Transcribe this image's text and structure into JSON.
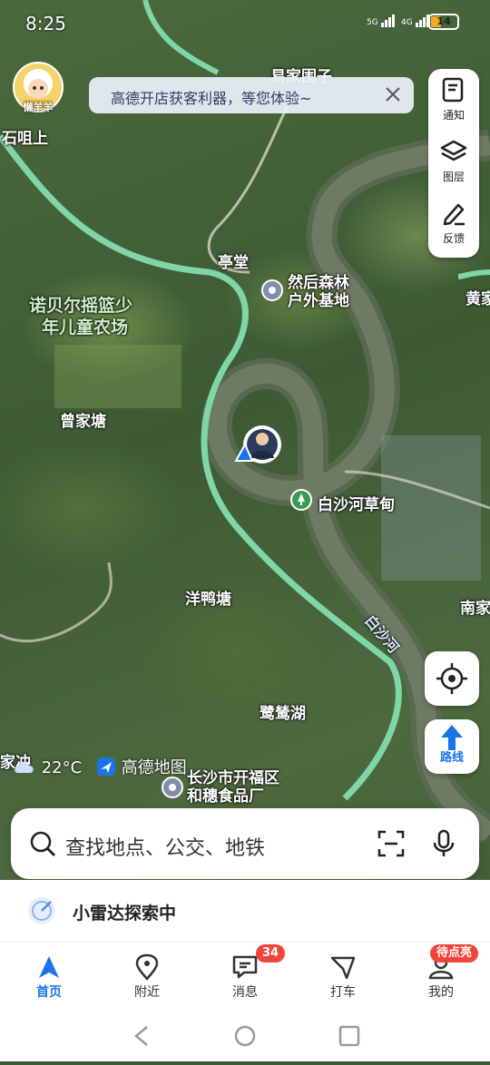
{
  "status_bar": {
    "time": "8:25",
    "signal1": "5G",
    "signal2": "4G",
    "battery": "14"
  },
  "avatar": {
    "name": "懒羊羊"
  },
  "banner": {
    "text": "高德开店获客利器，等您体验~"
  },
  "toolbox": {
    "notice": "通知",
    "layers": "图层",
    "feedback": "反馈"
  },
  "route_button": {
    "label": "路线"
  },
  "map_labels": {
    "top_village": "易家围子",
    "shi_ju_shang": "石咀上",
    "ting_tang": "亭堂",
    "poi_forest_line1": "然后森林",
    "poi_forest_line2": "户外基地",
    "huang_jia": "黄家",
    "farm_line1": "诺贝尔摇篮少",
    "farm_line2": "年儿童农场",
    "zeng_jia_tang": "曾家塘",
    "bai_sha_grassland": "白沙河草甸",
    "yang_ya_tang": "洋鸭塘",
    "nan_jia": "南家",
    "bai_sha_river": "白沙河",
    "lu_si_hu": "鹭鸶湖",
    "jia_chong": "家冲",
    "factory_line1": "长沙市开福区",
    "factory_line2": "和穗食品厂"
  },
  "weather": {
    "temp": "22°C",
    "brand": "高德地图"
  },
  "search": {
    "placeholder": "查找地点、公交、地铁"
  },
  "radar": {
    "text": "小雷达探索中"
  },
  "tabs": [
    {
      "label": "首页",
      "icon": "navigate-arrow-icon",
      "active": true
    },
    {
      "label": "附近",
      "icon": "location-pin-icon"
    },
    {
      "label": "消息",
      "icon": "message-icon",
      "badge": "34"
    },
    {
      "label": "打车",
      "icon": "taxi-icon"
    },
    {
      "label": "我的",
      "icon": "profile-icon",
      "badge": "待点亮"
    }
  ],
  "colors": {
    "accent": "#1a73e8",
    "road": "#8fe3b8",
    "badge": "#f0453a"
  }
}
